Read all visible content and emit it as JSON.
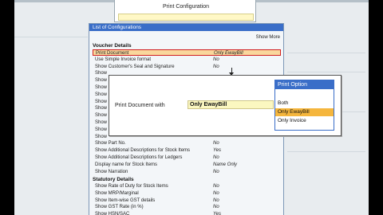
{
  "header": {
    "title": "Print Configuration"
  },
  "panel": {
    "title": "List of Configurations",
    "show_more": "Show More",
    "voucher_section": "Voucher Details",
    "statutory_section": "Statutory Details",
    "voucher_rows": [
      {
        "label": "Print Document",
        "value": "Only EwayBill",
        "highlighted": true
      },
      {
        "label": "Use Simple Invoice format",
        "value": "No"
      },
      {
        "label": "Show Customer's Seal and Signature",
        "value": "No"
      },
      {
        "label": "Show",
        "value": ""
      },
      {
        "label": "Show",
        "value": ""
      },
      {
        "label": "Show",
        "value": ""
      },
      {
        "label": "Show",
        "value": ""
      },
      {
        "label": "Show",
        "value": ""
      },
      {
        "label": "Show",
        "value": ""
      },
      {
        "label": "Show",
        "value": ""
      },
      {
        "label": "Show",
        "value": ""
      },
      {
        "label": "Show",
        "value": ""
      },
      {
        "label": "Show",
        "value": ""
      },
      {
        "label": "Show Part No.",
        "value": "No"
      },
      {
        "label": "Show Additional Descriptions for Stock Items",
        "value": "Yes"
      },
      {
        "label": "Show Additional Descriptions for Ledgers",
        "value": "No"
      },
      {
        "label": "Display name for Stock Items",
        "value": "Name Only"
      },
      {
        "label": "Show Narration",
        "value": "No"
      }
    ],
    "statutory_rows": [
      {
        "label": "Show Rate of Duty for Stock Items",
        "value": "No"
      },
      {
        "label": "Show MRP/Marginal",
        "value": "No"
      },
      {
        "label": "Show Item-wise GST details",
        "value": "No"
      },
      {
        "label": "Show GST Rate (in %)",
        "value": "No"
      },
      {
        "label": "Show HSN/SAC",
        "value": "Yes"
      }
    ]
  },
  "popup": {
    "label": "Print Document with",
    "value": "Only EwayBill"
  },
  "options": {
    "title": "Print Option",
    "items": [
      "Both",
      "Only EwayBill",
      "Only Invoice"
    ],
    "selected": "Only EwayBill"
  },
  "colors": {
    "header_blue": "#3a6ec8",
    "selected_orange": "#f5b63d",
    "highlight_border": "#d11f1f"
  }
}
